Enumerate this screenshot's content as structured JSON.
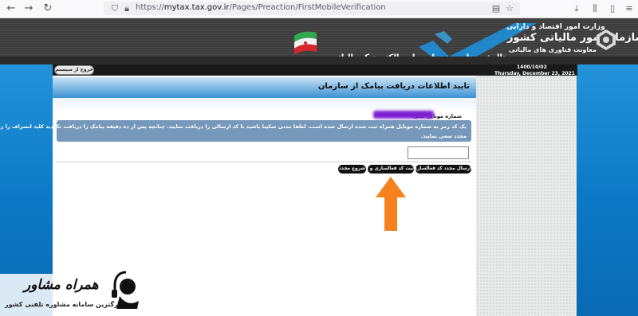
{
  "browser": {
    "url_prefix": "https://",
    "url_host": "mytax.tax.gov.ir",
    "url_path": "/Pages/Preaction/FirstMobileVerification"
  },
  "header": {
    "ministry": "وزارت امور اقتصاد و دارایی",
    "org_name": "سازمان امور مالیاتی کشور",
    "deputy": "معاونت فناوری های مالیاتی",
    "portal_title": "پرتال ثبت نام و خدمات جامع الکترونیک مالیاتی",
    "date_fa": "1400/10/02",
    "date_en": "Thursday, December 23, 2021",
    "logout_label": "خروج از سیستم"
  },
  "page": {
    "title": "تایید اطلاعات دریافت پیامک از سازمان",
    "mobile_label": "شماره موبایل ثبتی:",
    "notice_line1": "یک کد رمز به شماره موبایل همراه ثبت شده ارسال شده است. لطفا مدتی شکیبا باشید تا کد ارسالی را دریافت نمایید. چنانچه پس از ده دقیقه پیامک را دریافت نکردید کلید انصراف را زده و",
    "notice_line2": "مجدد سعی نمایید.",
    "code_value": ""
  },
  "buttons": {
    "resend": "ارسال مجدد کد فعالسازی",
    "submit": "ثبت کد فعالسازی و ادامه",
    "restart": "شروع مجدد"
  },
  "watermark": {
    "title": "همراه مشاور",
    "subtitle": "بزرگترین سامانه مشاوره تلفنی کشور"
  },
  "colors": {
    "accent_arrow": "#f5821f",
    "notice_bg": "#7698bb",
    "site_blue": "#0d79c6"
  }
}
